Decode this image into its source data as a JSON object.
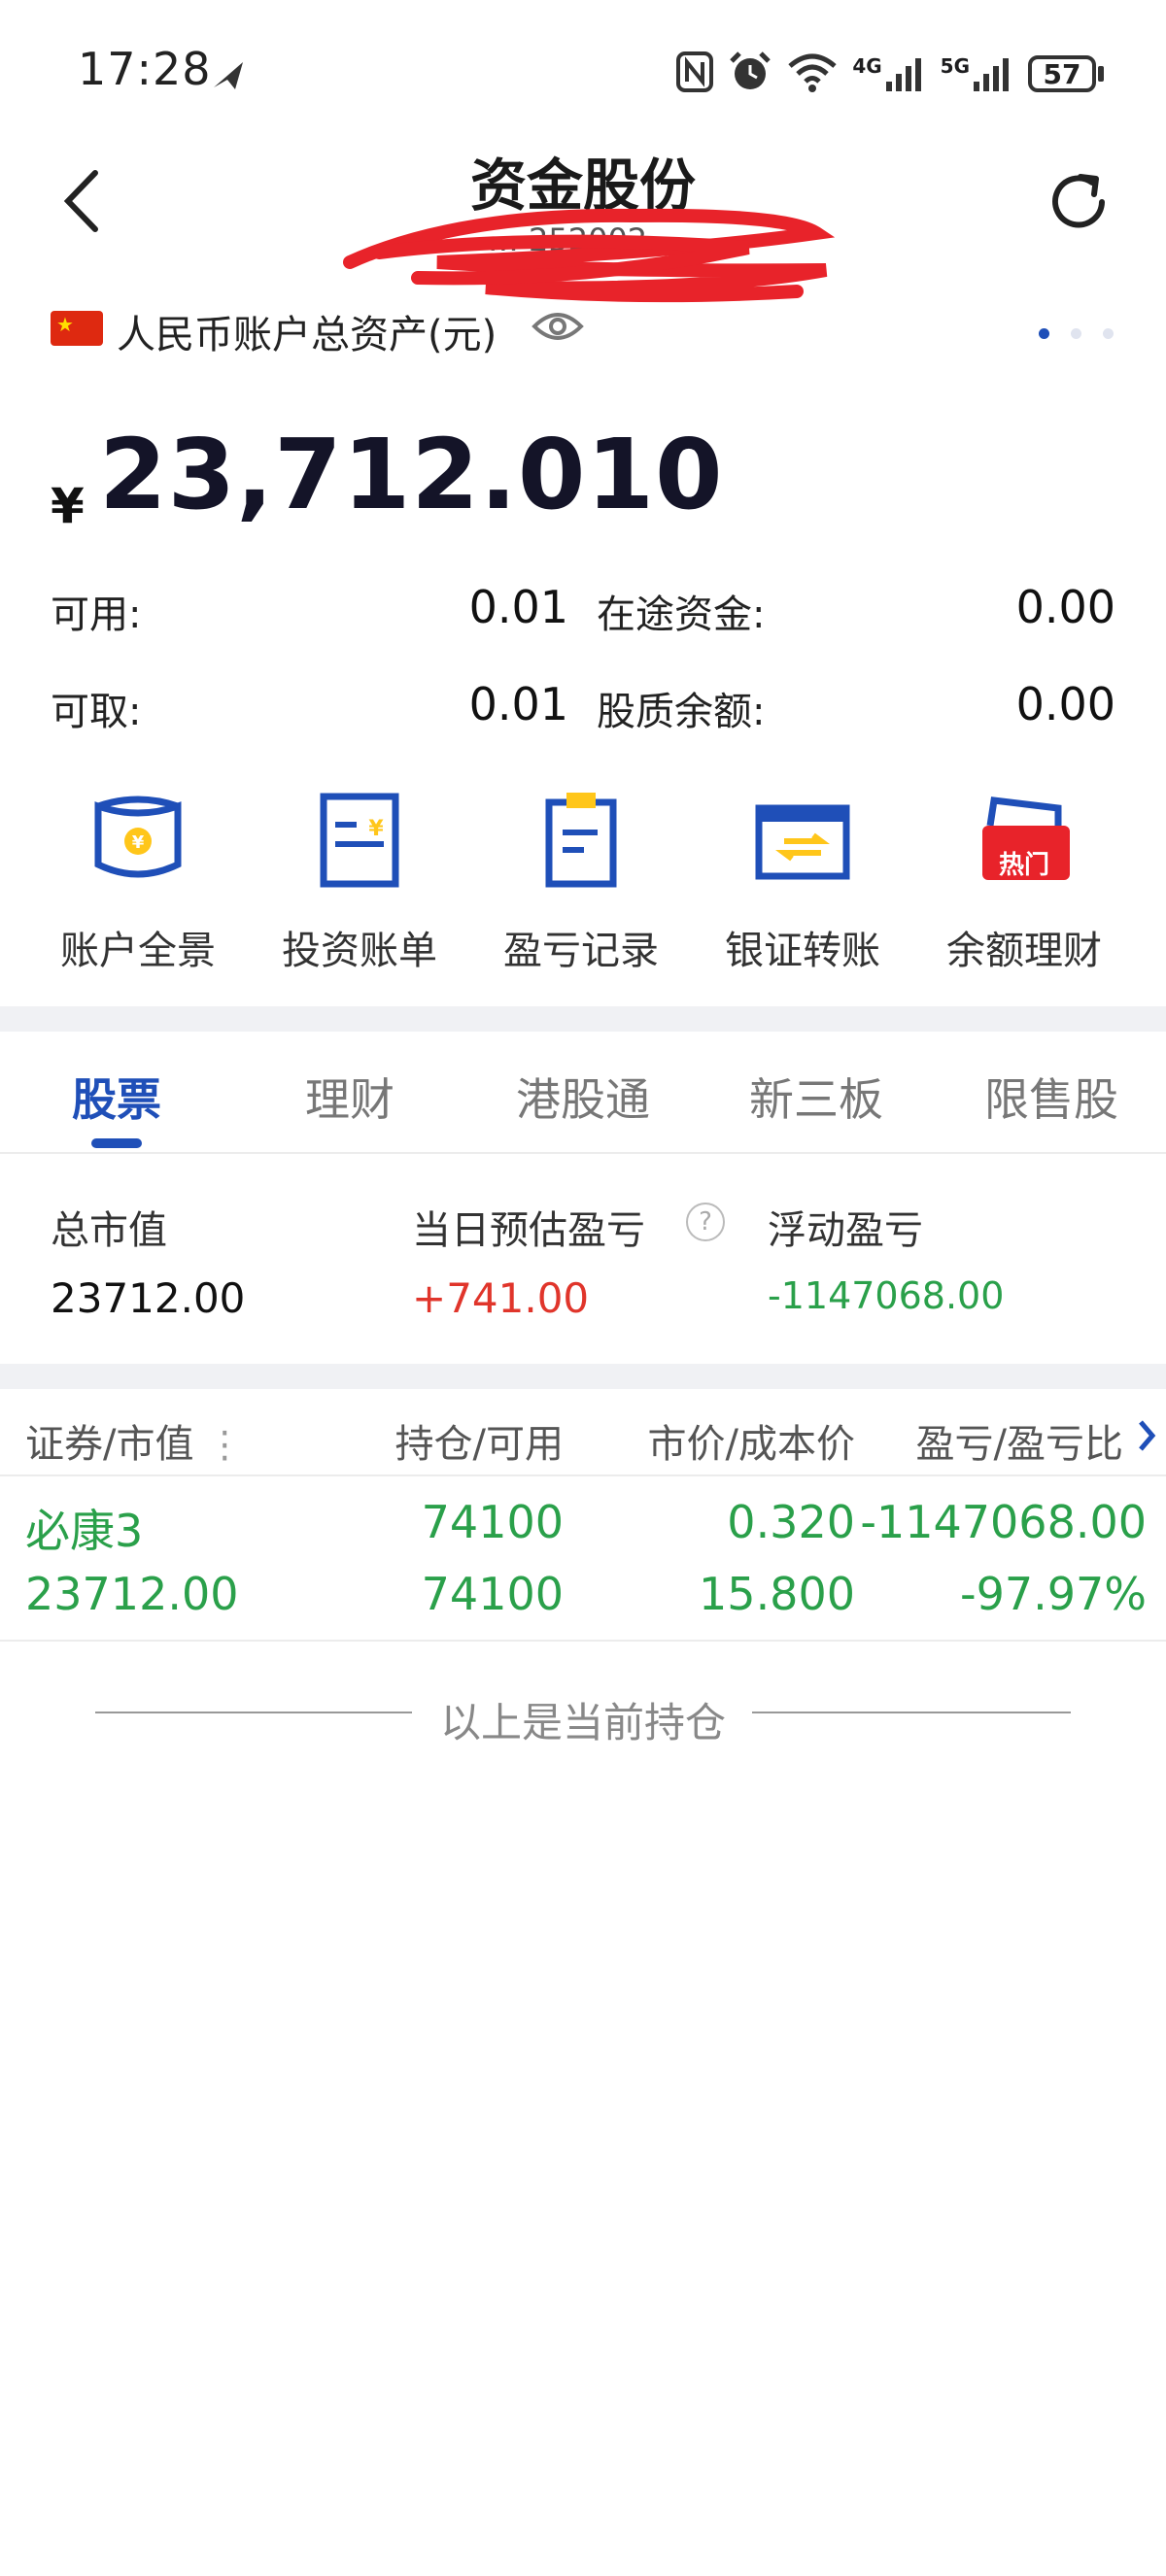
{
  "status_bar": {
    "time": "17:28",
    "battery": "57",
    "net_4g": "4G",
    "net_5g": "5G"
  },
  "header": {
    "title": "资金股份",
    "subtitle": "… 252002…"
  },
  "asset": {
    "label": "人民币账户总资产(元)",
    "currency_symbol": "¥",
    "total": "23,712.010"
  },
  "balances": [
    {
      "label": "可用:",
      "value": "0.01"
    },
    {
      "label": "在途资金:",
      "value": "0.00"
    },
    {
      "label": "可取:",
      "value": "0.01"
    },
    {
      "label": "股质余额:",
      "value": "0.00"
    }
  ],
  "quick_actions": [
    {
      "label": "账户全景",
      "icon": "account-panorama-icon"
    },
    {
      "label": "投资账单",
      "icon": "invest-bill-icon"
    },
    {
      "label": "盈亏记录",
      "icon": "pnl-record-icon"
    },
    {
      "label": "银证转账",
      "icon": "bank-transfer-icon"
    },
    {
      "label": "余额理财",
      "icon": "balance-finance-icon",
      "badge": "热门"
    }
  ],
  "tabs": [
    {
      "label": "股票",
      "active": true
    },
    {
      "label": "理财"
    },
    {
      "label": "港股通"
    },
    {
      "label": "新三板"
    },
    {
      "label": "限售股"
    }
  ],
  "summary": {
    "market_value_label": "总市值",
    "market_value": "23712.00",
    "daily_pnl_label": "当日预估盈亏",
    "daily_pnl": "+741.00",
    "floating_pnl_label": "浮动盈亏",
    "floating_pnl": "-1147068.00"
  },
  "holdings_table": {
    "headers": [
      "证券/市值",
      "持仓/可用",
      "市价/成本价",
      "盈亏/盈亏比"
    ],
    "rows": [
      {
        "name": "必康3",
        "market_value": "23712.00",
        "position": "74100",
        "available": "74100",
        "price": "0.320",
        "cost": "15.800",
        "pnl": "-1147068.00",
        "pnl_ratio": "-97.97%"
      }
    ]
  },
  "footer_note": "以上是当前持仓",
  "colors": {
    "accent": "#1f4fb8",
    "up_red": "#e0352b",
    "down_green": "#2aa04a"
  }
}
